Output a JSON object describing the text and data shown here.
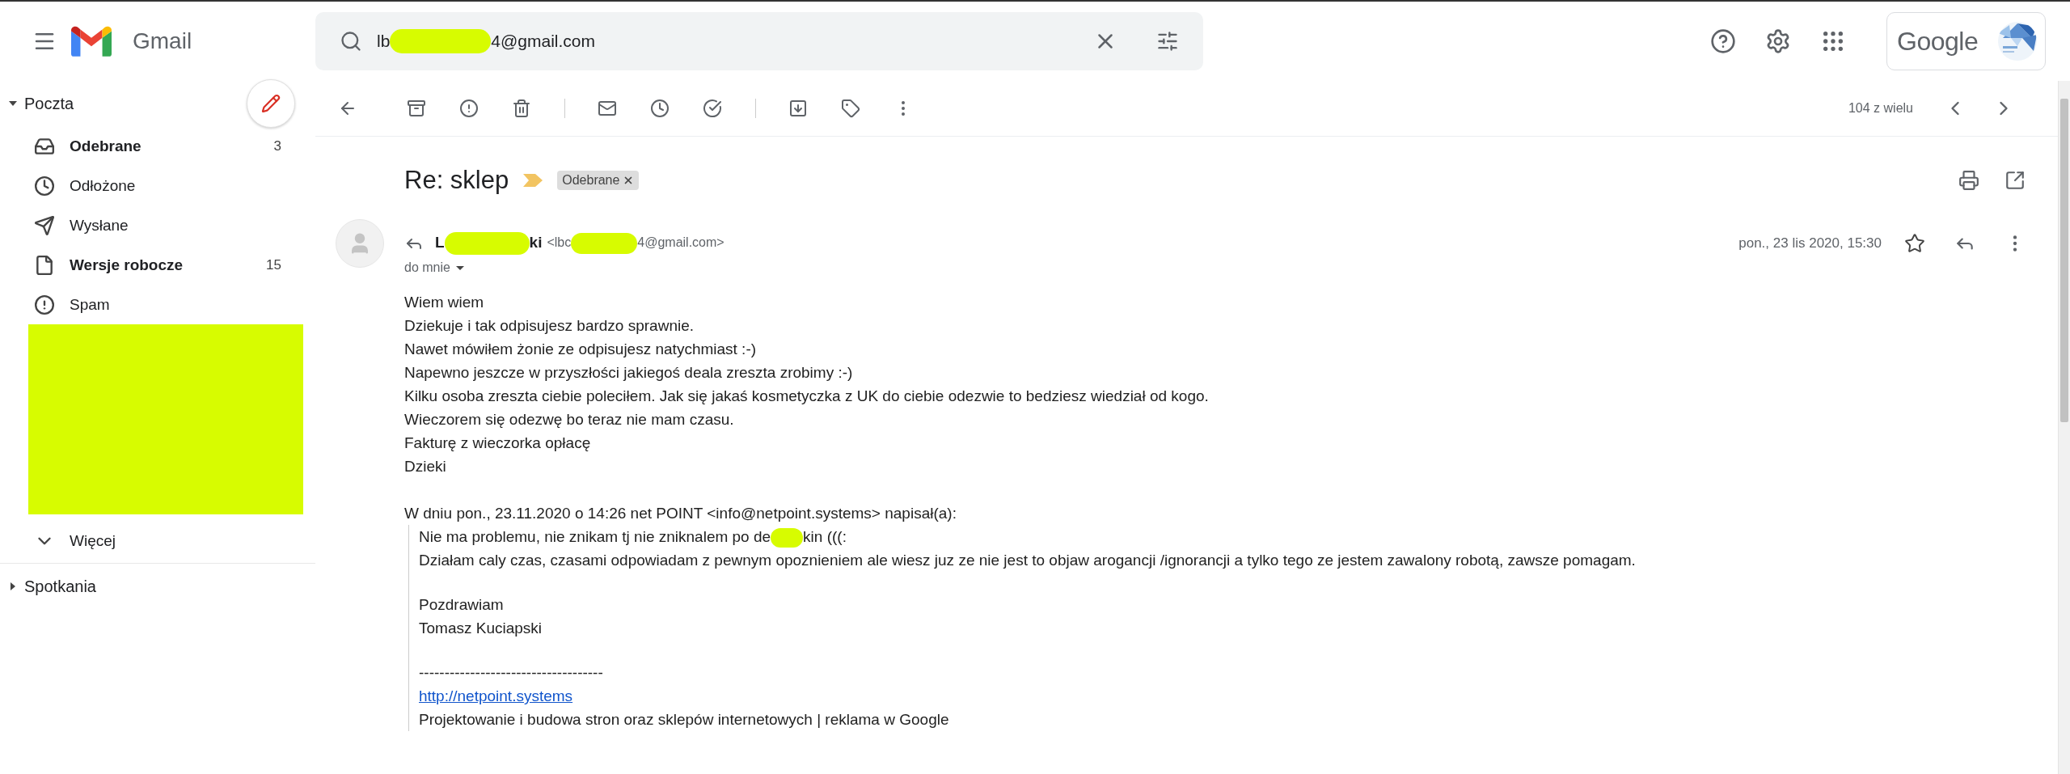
{
  "app": {
    "name": "Gmail"
  },
  "search": {
    "value_parts": [
      "lb",
      "4@gmail.com"
    ]
  },
  "account": {
    "label": "Google"
  },
  "sidebar": {
    "sections": [
      {
        "title": "Poczta",
        "expanded": true,
        "items": [
          {
            "kind": "folder",
            "label": "Odebrane",
            "count": "3",
            "unread": true
          },
          {
            "kind": "folder",
            "label": "Odłożone",
            "unread": false
          },
          {
            "kind": "folder",
            "label": "Wysłane",
            "unread": false
          },
          {
            "kind": "folder",
            "label": "Wersje robocze",
            "count": "15",
            "unread": true
          },
          {
            "kind": "folder",
            "label": "Spam",
            "unread": false
          },
          {
            "kind": "redaction"
          },
          {
            "kind": "more",
            "label": "Więcej"
          }
        ]
      },
      {
        "title": "Spotkania",
        "expanded": false
      }
    ]
  },
  "toolbar": {
    "pagination": "104 z wielu"
  },
  "message": {
    "subject": "Re: sklep",
    "important": true,
    "labels": [
      {
        "label": "Odebrane"
      }
    ],
    "sender": {
      "name_parts": [
        "L",
        "ki"
      ],
      "email_parts": [
        "<lbc",
        "4@gmail.com>"
      ]
    },
    "recipient": "do mnie",
    "date": "pon., 23 lis 2020, 15:30",
    "starred": false,
    "body": [
      "Wiem wiem",
      "Dziekuje i tak odpisujesz bardzo sprawnie.",
      "Nawet mówiłem żonie ze odpisujesz natychmiast :-)",
      "Napewno jeszcze w przyszłości jakiegoś deala zreszta zrobimy :-)",
      "Kilku osoba zreszta ciebie poleciłem. Jak się jakaś kosmetyczka z UK do ciebie odezwie to bedziesz wiedział od kogo.",
      "Wieczorem się odezwę bo teraz nie mam czasu.",
      "Fakturę z wieczorka opłacę",
      "Dzieki"
    ],
    "quote": {
      "header": "W dniu pon., 23.11.2020 o 14:26 net POINT <info@netpoint.systems> napisał(a):",
      "blocks": [
        [
          {
            "kind": "text",
            "parts": [
              "Nie ma problemu, nie znikam tj nie zniknalem po de",
              "kin (((:"
            ]
          },
          {
            "kind": "text",
            "parts": [
              "Działam caly czas, czasami odpowiadam z pewnym opoznieniem ale wiesz juz ze nie jest to objaw arogancji /ignorancji a tylko tego ze jestem zawalony robotą, zawsze pomagam."
            ]
          }
        ],
        [
          {
            "kind": "text",
            "parts": [
              "Pozdrawiam"
            ]
          },
          {
            "kind": "text",
            "parts": [
              "Tomasz Kuciapski"
            ]
          }
        ],
        [
          {
            "kind": "text",
            "parts": [
              "------------------------------------"
            ]
          },
          {
            "kind": "link",
            "parts": [
              "http://netpoint.systems"
            ]
          },
          {
            "kind": "text",
            "parts": [
              "Projektowanie i budowa stron oraz sklepów internetowych | reklama w Google"
            ]
          }
        ]
      ]
    }
  }
}
